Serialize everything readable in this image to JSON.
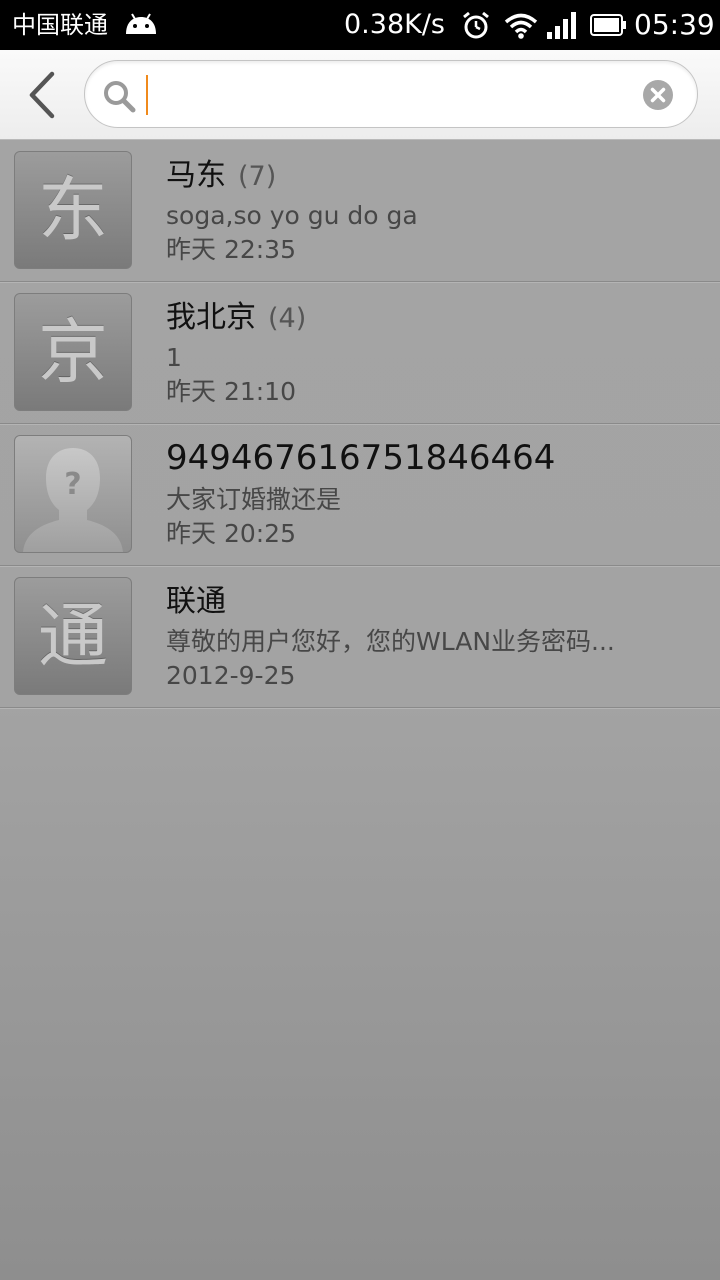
{
  "status_bar": {
    "carrier": "中国联通",
    "network_speed": "0.38K/s",
    "time": "05:39",
    "icons": [
      "android-icon",
      "alarm-icon",
      "wifi-icon",
      "signal-icon",
      "battery-icon"
    ]
  },
  "search": {
    "value": "",
    "placeholder": "",
    "accent_color": "#f08a1c"
  },
  "conversations": [
    {
      "avatar": "东",
      "name": "马东",
      "count": "(7)",
      "snippet": "soga,so yo gu do ga",
      "time": "昨天 22:35"
    },
    {
      "avatar": "京",
      "name": "我北京",
      "count": "(4)",
      "snippet": "1",
      "time": "昨天 21:10"
    },
    {
      "avatar": "",
      "avatar_icon": "unknown-contact-icon",
      "name": "949467616751846464",
      "count": "",
      "snippet": "大家订婚撒还是",
      "time": "昨天 20:25"
    },
    {
      "avatar": "通",
      "name": "联通",
      "count": "",
      "snippet": "尊敬的用户您好，您的WLAN业务密码...",
      "time": "2012-9-25"
    }
  ]
}
